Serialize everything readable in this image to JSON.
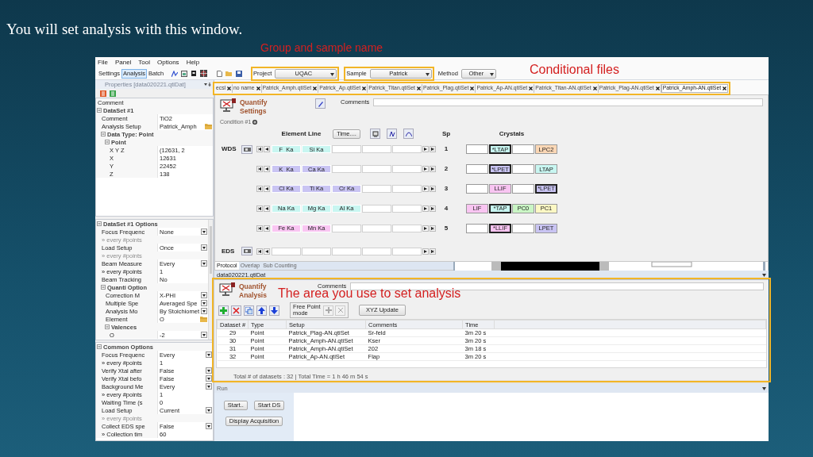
{
  "slide_title": "You will set analysis with this window.",
  "annotations": [
    {
      "text": "Group and sample name"
    },
    {
      "text": "Conditional files"
    },
    {
      "text": "The area you use to set analysis"
    }
  ],
  "menu": [
    "File",
    "Panel",
    "Tool",
    "Options",
    "Help"
  ],
  "mode_tabs": [
    {
      "label": "Settings",
      "selected": false
    },
    {
      "label": "Analysis",
      "selected": true
    },
    {
      "label": "Batch",
      "selected": false
    }
  ],
  "toolbar": {
    "project_label": "Project",
    "project": "UQAC",
    "sample_label": "Sample",
    "sample": "Patrick",
    "method_label": "Method",
    "method": "Other"
  },
  "properties": {
    "title": "Properties [data020221.qtiDat]",
    "tree": [
      {
        "kind": "header",
        "label": "Comment"
      },
      {
        "kind": "group",
        "label": "DataSet #1",
        "expanded": true,
        "children": [
          {
            "kind": "prop",
            "label": "Comment",
            "value": "TiO2"
          },
          {
            "kind": "browse",
            "label": "Analysis Setup",
            "value": "Patrick_Amph"
          },
          {
            "kind": "group",
            "label": "Data Type: Point",
            "expanded": true,
            "children": [
              {
                "kind": "group",
                "label": "Point",
                "expanded": true,
                "children": [
                  {
                    "kind": "prop",
                    "label": "X Y Z",
                    "value": "(12631, 2"
                  },
                  {
                    "kind": "prop",
                    "label": "X",
                    "value": "12631"
                  },
                  {
                    "kind": "prop",
                    "label": "Y",
                    "value": "22452"
                  },
                  {
                    "kind": "prop",
                    "label": "Z",
                    "value": "138"
                  }
                ]
              }
            ]
          }
        ]
      }
    ]
  },
  "dataset_options": [
    {
      "kind": "group",
      "label": "DataSet #1 Options",
      "expanded": true,
      "children": [
        {
          "kind": "select",
          "label": "Focus Frequenc",
          "value": "None"
        },
        {
          "kind": "note",
          "label": "» every #points"
        },
        {
          "kind": "select",
          "label": "Load Setup",
          "value": "Once"
        },
        {
          "kind": "note",
          "label": "» every #points"
        },
        {
          "kind": "select",
          "label": "Beam Measure",
          "value": "Every"
        },
        {
          "kind": "prop",
          "label": "» every #points",
          "value": "1"
        },
        {
          "kind": "prop",
          "label": "Beam Tracking",
          "value": "No"
        },
        {
          "kind": "group",
          "label": "Quanti Option",
          "expanded": true,
          "children": [
            {
              "kind": "select",
              "label": "Correction M",
              "value": "X-PHI"
            },
            {
              "kind": "select",
              "label": "Multiple Spe",
              "value": "Averaged Spe"
            },
            {
              "kind": "select",
              "label": "Analysis Mo",
              "value": "By Stoichiomet"
            },
            {
              "kind": "browse",
              "label": "Element",
              "value": "O"
            },
            {
              "kind": "group",
              "label": "Valences",
              "expanded": true,
              "children": [
                {
                  "kind": "select",
                  "label": "O",
                  "value": "-2"
                }
              ]
            }
          ]
        }
      ]
    }
  ],
  "common_options": [
    {
      "kind": "group",
      "label": "Common Options",
      "expanded": true,
      "children": [
        {
          "kind": "select",
          "label": "Focus Frequenc",
          "value": "Every"
        },
        {
          "kind": "prop",
          "label": "» every #points",
          "value": "1"
        },
        {
          "kind": "select",
          "label": "Verify Xtal after",
          "value": "False"
        },
        {
          "kind": "select",
          "label": "Verify Xtal befo",
          "value": "False"
        },
        {
          "kind": "select",
          "label": "Background Me",
          "value": "Every"
        },
        {
          "kind": "prop",
          "label": "» every #points",
          "value": "1"
        },
        {
          "kind": "prop",
          "label": "Waiting Time (s",
          "value": "0"
        },
        {
          "kind": "select",
          "label": "Load Setup",
          "value": "Current"
        },
        {
          "kind": "note",
          "label": "» every #points"
        },
        {
          "kind": "select",
          "label": "Collect EDS spe",
          "value": "False"
        },
        {
          "kind": "prop",
          "label": "» Collection tim",
          "value": "60"
        }
      ]
    }
  ],
  "file_tabs": [
    {
      "label": "ecsl",
      "selected": false
    },
    {
      "label": "no name",
      "selected": false
    },
    {
      "label": "Patrick_Amph.qtiSet",
      "selected": false
    },
    {
      "label": "Patrick_Ap.qtiSet",
      "selected": false
    },
    {
      "label": "Patrick_Titan.qtiSet",
      "selected": false
    },
    {
      "label": "Patrick_Plag.qtiSet",
      "selected": false
    },
    {
      "label": "Patrick_Ap-AN.qtiSet",
      "selected": false
    },
    {
      "label": "Patrick_Titan-AN.qtiSet",
      "selected": false
    },
    {
      "label": "Patrick_Plag-AN.qtiSet",
      "selected": false
    },
    {
      "label": "Patrick_Amph-AN.qtiSet",
      "selected": true
    }
  ],
  "quantify_settings": {
    "title": "Quantify Settings",
    "comments_label": "Comments",
    "condition": "Condition #1",
    "element_header": "Element Line",
    "time_button": "Time....",
    "sp_header": "Sp",
    "crystals_header": "Crystals",
    "wds_label": "WDS",
    "eds_label": "EDS",
    "spectrometers": [
      {
        "sp": "1",
        "elements": [
          {
            "label": "F  Ka",
            "color": "#c8f6f1"
          },
          {
            "label": "Si Ka",
            "color": "#c8f6f1"
          }
        ],
        "crystals": [
          {
            "kind": "empty"
          },
          {
            "kind": "chip",
            "label": "*LTAP",
            "color": "#c8f6f1",
            "selected": true
          },
          {
            "kind": "empty"
          },
          {
            "kind": "chip",
            "label": "LPC2",
            "color": "#fbd7b5",
            "selected": false
          }
        ]
      },
      {
        "sp": "2",
        "elements": [
          {
            "label": "K  Ka",
            "color": "#c9c4f3"
          },
          {
            "label": "Ca Ka",
            "color": "#c9c4f3"
          }
        ],
        "crystals": [
          {
            "kind": "empty"
          },
          {
            "kind": "chip",
            "label": "*LPET",
            "color": "#c9c4f3",
            "selected": true
          },
          {
            "kind": "empty"
          },
          {
            "kind": "chip",
            "label": "LTAP",
            "color": "#c8f6f1",
            "selected": false
          }
        ]
      },
      {
        "sp": "3",
        "elements": [
          {
            "label": "Cl Ka",
            "color": "#c9c4f3"
          },
          {
            "label": "Ti Ka",
            "color": "#c9c4f3"
          },
          {
            "label": "Cr Ka",
            "color": "#c9c4f3"
          }
        ],
        "crystals": [
          {
            "kind": "empty"
          },
          {
            "kind": "chip",
            "label": "LLIF",
            "color": "#f9c5f2",
            "selected": false
          },
          {
            "kind": "empty"
          },
          {
            "kind": "chip",
            "label": "*LPET",
            "color": "#c9c4f3",
            "selected": true
          }
        ]
      },
      {
        "sp": "4",
        "elements": [
          {
            "label": "Na Ka",
            "color": "#c8f6f1"
          },
          {
            "label": "Mg Ka",
            "color": "#c8f6f1"
          },
          {
            "label": "Al Ka",
            "color": "#c8f6f1"
          }
        ],
        "crystals": [
          {
            "kind": "chip",
            "label": "LIF",
            "color": "#f9c5f2",
            "selected": false
          },
          {
            "kind": "chip",
            "label": "*TAP",
            "color": "#c8f6f1",
            "selected": true
          },
          {
            "kind": "chip",
            "label": "PC0",
            "color": "#caf6c5",
            "selected": false
          },
          {
            "kind": "chip",
            "label": "PC1",
            "color": "#fcf8c4",
            "selected": false
          }
        ]
      },
      {
        "sp": "5",
        "elements": [
          {
            "label": "Fe Ka",
            "color": "#f9c5f2"
          },
          {
            "label": "Mn Ka",
            "color": "#f9c5f2"
          }
        ],
        "crystals": [
          {
            "kind": "empty"
          },
          {
            "kind": "chip",
            "label": "*LLIF",
            "color": "#f9c5f2",
            "selected": true
          },
          {
            "kind": "empty"
          },
          {
            "kind": "chip",
            "label": "LPET",
            "color": "#c9c4f3",
            "selected": false
          }
        ]
      }
    ]
  },
  "protocol_tabs": [
    {
      "label": "Protocol",
      "selected": true
    },
    {
      "label": "Overlap",
      "selected": false
    },
    {
      "label": "Sub Counting",
      "selected": false
    }
  ],
  "data_panel": {
    "title": "data020221.qtiDat"
  },
  "quantify_analysis": {
    "title": "Quantify Analysis",
    "comments_label": "Comments",
    "free_point_label": "Free Point mode",
    "xyz_button": "XYZ Update",
    "columns": [
      "Dataset #",
      "Type",
      "Setup",
      "Comments",
      "Time"
    ],
    "rows": [
      [
        "29",
        "Point",
        "Patrick_Plag-AN.qtiSet",
        "Sr-feld",
        "3m 20 s"
      ],
      [
        "30",
        "Point",
        "Patrick_Amph-AN.qtiSet",
        "Kser",
        "3m 20 s"
      ],
      [
        "31",
        "Point",
        "Patrick_Amph-AN.qtiSet",
        "202",
        "3m 18 s"
      ],
      [
        "32",
        "Point",
        "Patrick_Ap-AN.qtiSet",
        "Flap",
        "3m 20 s"
      ]
    ],
    "footer": "Total # of datasets : 32  | Total Time = 1 h 46 m 54 s"
  },
  "run": {
    "title": "Run",
    "buttons": [
      "Start..",
      "Start DS",
      "Display Acquisition"
    ]
  }
}
